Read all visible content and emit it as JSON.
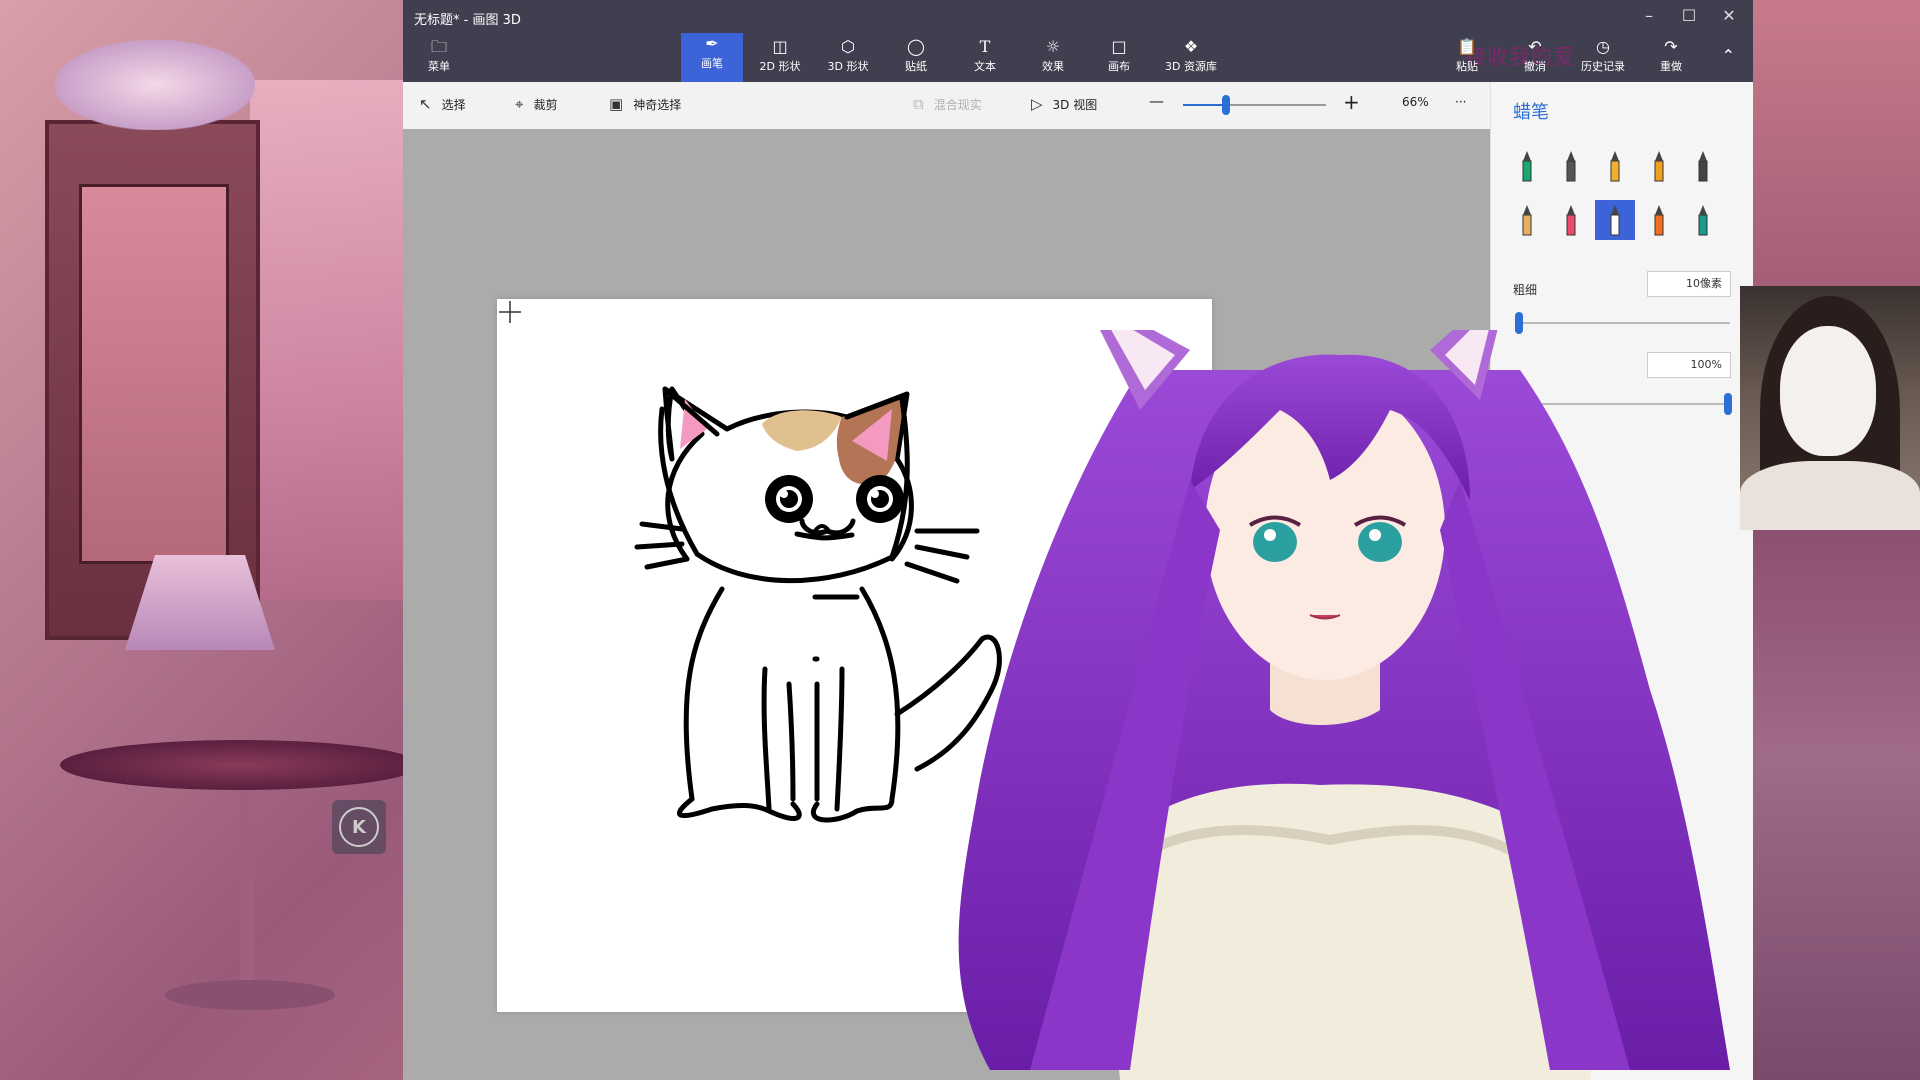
{
  "window": {
    "title": "无标题* - 画图 3D"
  },
  "ribbon": {
    "menu_label": "菜单",
    "tabs": [
      {
        "label": "画笔",
        "icon": "brush-icon"
      },
      {
        "label": "2D 形状",
        "icon": "2d-shapes-icon"
      },
      {
        "label": "3D 形状",
        "icon": "3d-shapes-icon"
      },
      {
        "label": "贴纸",
        "icon": "stickers-icon"
      },
      {
        "label": "文本",
        "icon": "text-icon"
      },
      {
        "label": "效果",
        "icon": "effects-icon"
      },
      {
        "label": "画布",
        "icon": "canvas-icon"
      },
      {
        "label": "3D 资源库",
        "icon": "3d-library-icon"
      }
    ],
    "active_tab": "画笔",
    "actions": [
      {
        "label": "粘贴",
        "icon": "paste-icon"
      },
      {
        "label": "撤消",
        "icon": "undo-icon"
      },
      {
        "label": "历史记录",
        "icon": "history-icon"
      },
      {
        "label": "重做",
        "icon": "redo-icon"
      }
    ]
  },
  "overlay_caption": "接收我的爱",
  "toolbar": {
    "select_label": "选择",
    "crop_label": "裁剪",
    "magic_select_label": "神奇选择",
    "mixed_reality_label": "混合现实",
    "view3d_label": "3D 视图",
    "zoom_out": "—",
    "zoom_in": "+",
    "zoom_value": "66%",
    "zoom_fraction": 0.3,
    "more": "···"
  },
  "panel": {
    "title": "蜡笔",
    "brushes": [
      {
        "name": "marker",
        "color": "#1aa870"
      },
      {
        "name": "calligraphy-pen",
        "color": "#555555"
      },
      {
        "name": "oil-brush",
        "color": "#f0b030"
      },
      {
        "name": "watercolor",
        "color": "#f2a020"
      },
      {
        "name": "pixel-pen",
        "color": "#444444"
      },
      {
        "name": "pencil",
        "color": "#e8b060"
      },
      {
        "name": "eraser",
        "color": "#e84a6a"
      },
      {
        "name": "crayon",
        "color": "#ffffff"
      },
      {
        "name": "spray-can",
        "color": "#f07020"
      },
      {
        "name": "fill-bucket",
        "color": "#1a9a8a"
      }
    ],
    "selected_brush": "crayon",
    "thickness_label": "粗细",
    "thickness_value": "10像素",
    "thickness_fraction": 0.0,
    "opacity_value": "100%",
    "opacity_fraction": 1.0
  },
  "colors": {
    "accent": "#3c64d8",
    "titlebar": "#3f3f4f",
    "hair": "#8a3ac8"
  }
}
